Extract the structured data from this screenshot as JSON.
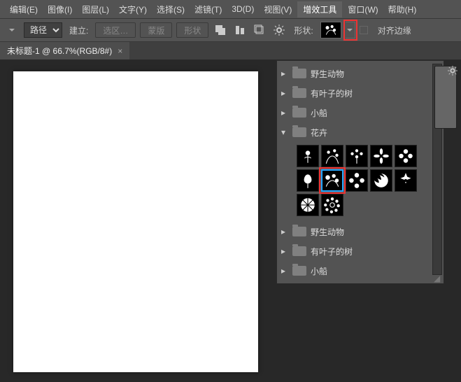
{
  "menus": {
    "edit": "编辑(E)",
    "image": "图像(I)",
    "layer": "图层(L)",
    "text": "文字(Y)",
    "select": "选择(S)",
    "filter": "滤镜(T)",
    "3d": "3D(D)",
    "view": "视图(V)",
    "fx": "增效工具",
    "window": "窗口(W)",
    "help": "帮助(H)"
  },
  "toolbar": {
    "path_label": "路径",
    "build_label": "建立:",
    "select_btn": "选区…",
    "mask_btn": "蒙版",
    "shape_btn": "形状",
    "shape_label": "形状:",
    "align_label": "对齐边缘"
  },
  "tab": {
    "title": "未标题-1 @ 66.7%(RGB/8#)"
  },
  "panel": {
    "groups": [
      {
        "label": "野生动物",
        "open": false
      },
      {
        "label": "有叶子的树",
        "open": false
      },
      {
        "label": "小船",
        "open": false
      },
      {
        "label": "花卉",
        "open": true
      },
      {
        "label": "野生动物",
        "open": false
      },
      {
        "label": "有叶子的树",
        "open": false
      },
      {
        "label": "小船",
        "open": false
      }
    ],
    "flowers": {
      "count": 12,
      "selected_index": 6
    }
  },
  "icons": {
    "gear": "gear-icon"
  }
}
